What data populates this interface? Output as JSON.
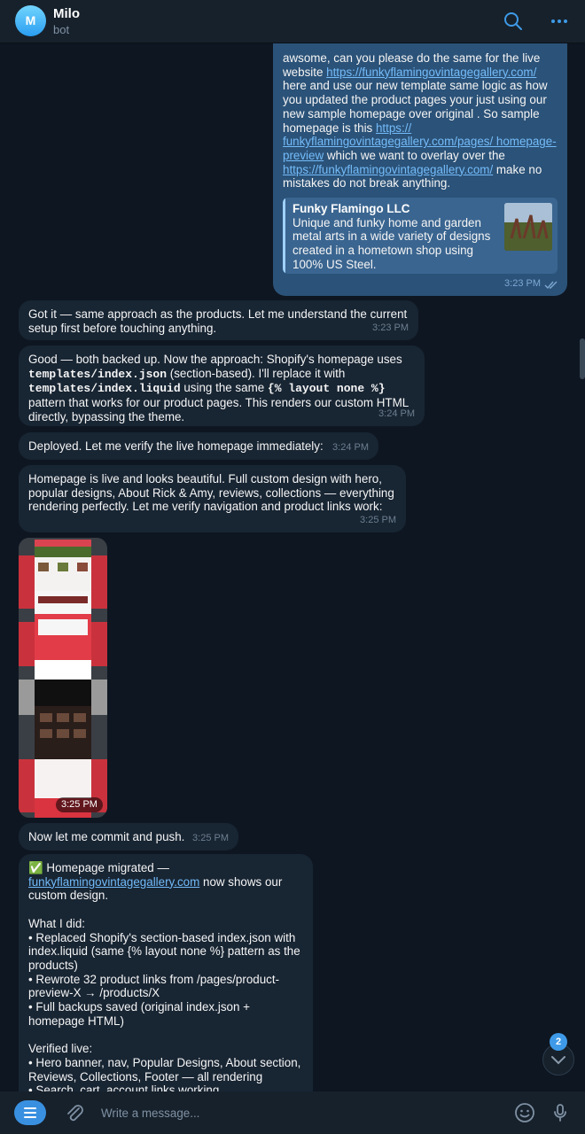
{
  "header": {
    "avatar_letter": "M",
    "title": "Milo",
    "subtitle": "bot",
    "icons": [
      "search-icon",
      "more-icon"
    ]
  },
  "messages": {
    "m0": {
      "p1": "awsome, can you please do the same for the live website ",
      "link1": "https://funkyflamingovintagegallery.com/",
      "p2": " here and use our new template same logic as how you updated the product pages your just using our new sample homepage over original . So sample homepage is this ",
      "link2": "https:// funkyflamingovintagegallery.com/pages/ homepage-preview",
      "p3": " which we want to overlay over the ",
      "link3": "https://funkyflamingovintagegallery.com/",
      "p4": " make no mistakes do not break anything.",
      "preview_title": "Funky Flamingo LLC",
      "preview_desc": "Unique and funky home and garden metal arts in a wide variety of designs created in a hometown shop using 100% US Steel.",
      "time": "3:23 PM"
    },
    "m1": {
      "text": "Got it — same approach as the products. Let me understand the current setup first before touching anything.",
      "time": "3:23 PM"
    },
    "m2": {
      "p1": "Good — both backed up. Now the approach: Shopify's homepage uses ",
      "c1": "templates/index.json",
      "p2": " (section-based). I'll replace it with ",
      "c2": "templates/index.liquid",
      "p3": " using the same ",
      "c3": "{% layout none %}",
      "p4": " pattern that works for our product pages. This renders our custom HTML directly, bypassing the theme.",
      "time": "3:24 PM"
    },
    "m3": {
      "text": "Deployed. Let me verify the live homepage immediately:",
      "time": "3:24 PM"
    },
    "m4": {
      "text": "Homepage is live and looks beautiful. Full custom design with hero, popular designs, About Rick & Amy, reviews, collections — everything rendering perfectly. Let me verify navigation and product links work:",
      "time": "3:25 PM"
    },
    "m5": {
      "time": "3:25 PM"
    },
    "m6": {
      "text": "Now let me commit and push.",
      "time": "3:25 PM"
    },
    "m7": {
      "emoji": "✅",
      "l1": " Homepage migrated — ",
      "link": "funkyflamingovintagegallery.com",
      "l2": " now shows our custom design.",
      "h1": "What I did:",
      "b1": "• Replaced Shopify's section-based index.json with index.liquid (same {% layout none %} pattern as the products)",
      "b2": "• Rewrote 32 product links from /pages/product-preview-X → /products/X",
      "b3": "• Full backups saved (original index.json + homepage HTML)",
      "h2": "Verified live:",
      "b4": "• Hero banner, nav, Popular Designs, About section, Reviews, Collections, Footer — all rendering",
      "b5": "• Search, cart, account links working"
    }
  },
  "composer": {
    "placeholder": "Write a message..."
  },
  "scroll_badge": "2",
  "colors": {
    "bg": "#0e1621",
    "incoming": "#182533",
    "outgoing": "#2b5278",
    "accent": "#3a90e0"
  }
}
